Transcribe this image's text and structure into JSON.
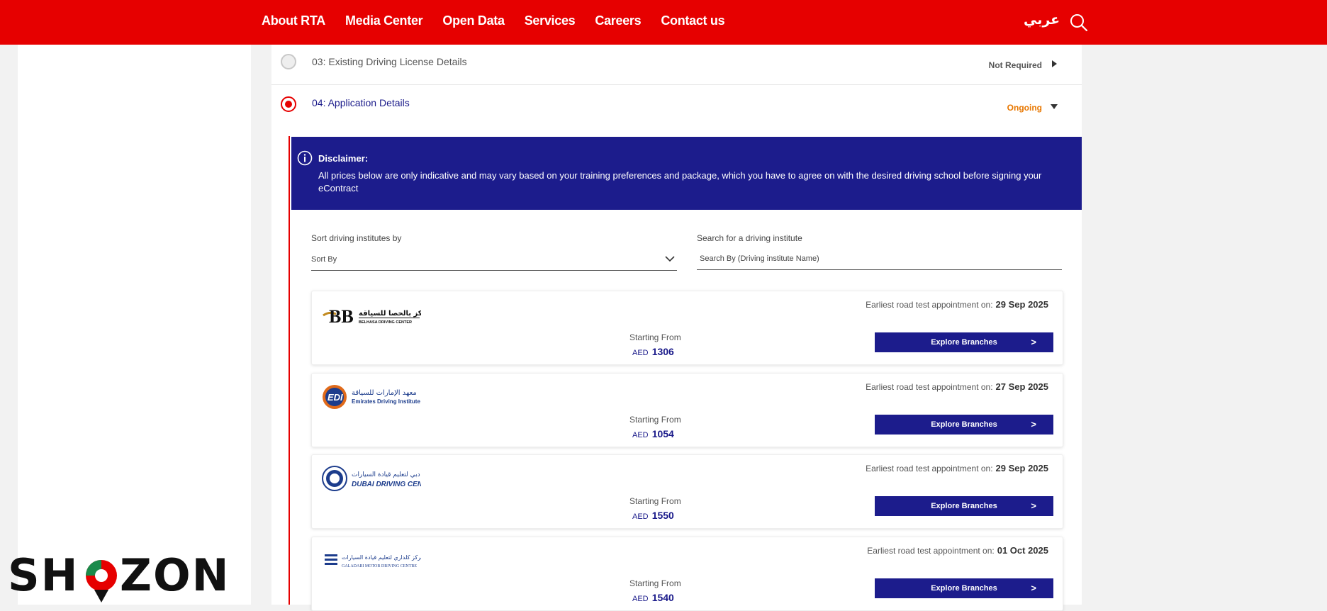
{
  "nav": {
    "items": [
      "About RTA",
      "Media Center",
      "Open Data",
      "Services",
      "Careers",
      "Contact us"
    ],
    "language_toggle": "عربي",
    "search_icon": "search-icon"
  },
  "steps": {
    "step3": {
      "title": "03: Existing Driving License Details",
      "status": "Not Required"
    },
    "step4": {
      "title": "04: Application Details",
      "status": "Ongoing"
    }
  },
  "disclaimer": {
    "title": "Disclaimer:",
    "text": "All prices below are only indicative and may vary based on your training preferences and package, which you have to agree on with the desired driving school before signing your eContract"
  },
  "filters": {
    "sort_label": "Sort driving institutes by",
    "sort_value": "Sort By",
    "search_label": "Search for a driving institute",
    "search_placeholder": "Search By (Driving institute Name)"
  },
  "cards": [
    {
      "logo_icon": "belhasa-driving-center-logo",
      "appointment_label": "Earliest road test appointment on:",
      "appointment_date": "29 Sep 2025",
      "starting_label": "Starting From",
      "currency": "AED",
      "price": "1306",
      "button_label": "Explore Branches",
      "button_arrow": ">"
    },
    {
      "logo_icon": "emirates-driving-institute-logo",
      "appointment_label": "Earliest road test appointment on:",
      "appointment_date": "27 Sep 2025",
      "starting_label": "Starting From",
      "currency": "AED",
      "price": "1054",
      "button_label": "Explore Branches",
      "button_arrow": ">"
    },
    {
      "logo_icon": "dubai-driving-center-logo",
      "appointment_label": "Earliest road test appointment on:",
      "appointment_date": "29 Sep 2025",
      "starting_label": "Starting From",
      "currency": "AED",
      "price": "1550",
      "button_label": "Explore Branches",
      "button_arrow": ">"
    },
    {
      "logo_icon": "galadari-motor-driving-centre-logo",
      "appointment_label": "Earliest road test appointment on:",
      "appointment_date": "01 Oct 2025",
      "starting_label": "Starting From",
      "currency": "AED",
      "price": "1540",
      "button_label": "Explore Branches",
      "button_arrow": ">"
    }
  ],
  "watermark": {
    "logo_icon": "shozon-watermark-logo"
  },
  "colors": {
    "brand_red": "#e60000",
    "navy": "#1c1c8c",
    "ongoing_orange": "#e87700"
  }
}
